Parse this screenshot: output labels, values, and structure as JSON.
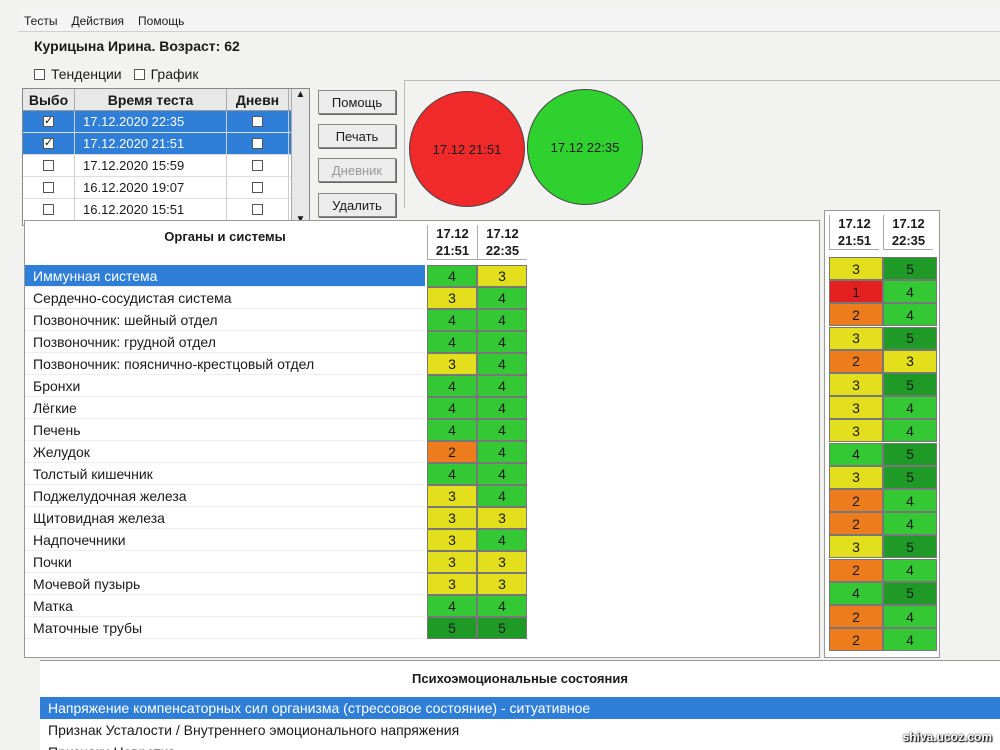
{
  "menu": [
    "Тесты",
    "Действия",
    "Помощь"
  ],
  "patient": "Курицына Ирина. Возраст: 62",
  "toggles": [
    {
      "label": "Тенденции",
      "checked": false
    },
    {
      "label": "График",
      "checked": false
    }
  ],
  "tests_table": {
    "headers": [
      "Выбо",
      "Время теста",
      "Дневн"
    ],
    "rows": [
      {
        "time": "17.12.2020 22:35",
        "selected": true,
        "checked": true
      },
      {
        "time": "17.12.2020 21:51",
        "selected": true,
        "checked": true
      },
      {
        "time": "17.12.2020 15:59",
        "selected": false,
        "checked": false
      },
      {
        "time": "16.12.2020 19:07",
        "selected": false,
        "checked": false
      },
      {
        "time": "16.12.2020 15:51",
        "selected": false,
        "checked": false
      }
    ]
  },
  "buttons": [
    {
      "label": "Помощь",
      "disabled": false
    },
    {
      "label": "Печать",
      "disabled": false
    },
    {
      "label": "Дневник",
      "disabled": true
    },
    {
      "label": "Удалить",
      "disabled": false
    }
  ],
  "circles": [
    {
      "label": "17.12 21:51",
      "color": "#f02a2a"
    },
    {
      "label": "17.12 22:35",
      "color": "#2fd12f"
    }
  ],
  "organs": {
    "title": "Органы и системы",
    "columns": [
      "17.12\n21:51",
      "17.12\n22:35"
    ],
    "rows": [
      {
        "name": "Иммунная система",
        "v": [
          4,
          3
        ],
        "selected": true
      },
      {
        "name": "Сердечно-сосудистая система",
        "v": [
          3,
          4
        ]
      },
      {
        "name": "Позвоночник: шейный отдел",
        "v": [
          4,
          4
        ]
      },
      {
        "name": "Позвоночник: грудной отдел",
        "v": [
          4,
          4
        ]
      },
      {
        "name": "Позвоночник: пояснично-крестцовый отдел",
        "v": [
          3,
          4
        ]
      },
      {
        "name": "Бронхи",
        "v": [
          4,
          4
        ]
      },
      {
        "name": "Лёгкие",
        "v": [
          4,
          4
        ]
      },
      {
        "name": "Печень",
        "v": [
          4,
          4
        ]
      },
      {
        "name": "Желудок",
        "v": [
          2,
          4
        ]
      },
      {
        "name": "Толстый кишечник",
        "v": [
          4,
          4
        ]
      },
      {
        "name": "Поджелудочная железа",
        "v": [
          3,
          4
        ]
      },
      {
        "name": "Щитовидная железа",
        "v": [
          3,
          3
        ]
      },
      {
        "name": "Надпочечники",
        "v": [
          3,
          4
        ]
      },
      {
        "name": "Почки",
        "v": [
          3,
          3
        ]
      },
      {
        "name": "Мочевой пузырь",
        "v": [
          3,
          3
        ]
      },
      {
        "name": "Матка",
        "v": [
          4,
          4
        ]
      },
      {
        "name": "Маточные трубы",
        "v": [
          5,
          5
        ]
      }
    ]
  },
  "right_panel": {
    "columns": [
      "17.12\n21:51",
      "17.12\n22:35"
    ],
    "rows": [
      [
        3,
        5
      ],
      [
        1,
        4
      ],
      [
        2,
        4
      ],
      [
        3,
        5
      ],
      [
        2,
        3
      ],
      [
        3,
        5
      ],
      [
        3,
        4
      ],
      [
        3,
        4
      ],
      [
        4,
        5
      ],
      [
        3,
        5
      ],
      [
        2,
        4
      ],
      [
        2,
        4
      ],
      [
        3,
        5
      ],
      [
        2,
        4
      ],
      [
        4,
        5
      ],
      [
        2,
        4
      ],
      [
        2,
        4
      ]
    ]
  },
  "score_colors": {
    "1": "#e52020",
    "2": "#ec7c1c",
    "3": "#e3df1c",
    "4": "#35c835",
    "5": "#1f9a26"
  },
  "psycho": {
    "title": "Психоэмоциональные состояния",
    "rows": [
      {
        "text": "Напряжение компенсаторных сил организма (стрессовое состояние) - ситуативное",
        "selected": true
      },
      {
        "text": "Признак Усталости / Внутреннего эмоционального напряжения",
        "selected": false
      },
      {
        "text": "Признаки Невротиз",
        "selected": false
      }
    ]
  },
  "watermark": "shiva.ucoz.com"
}
